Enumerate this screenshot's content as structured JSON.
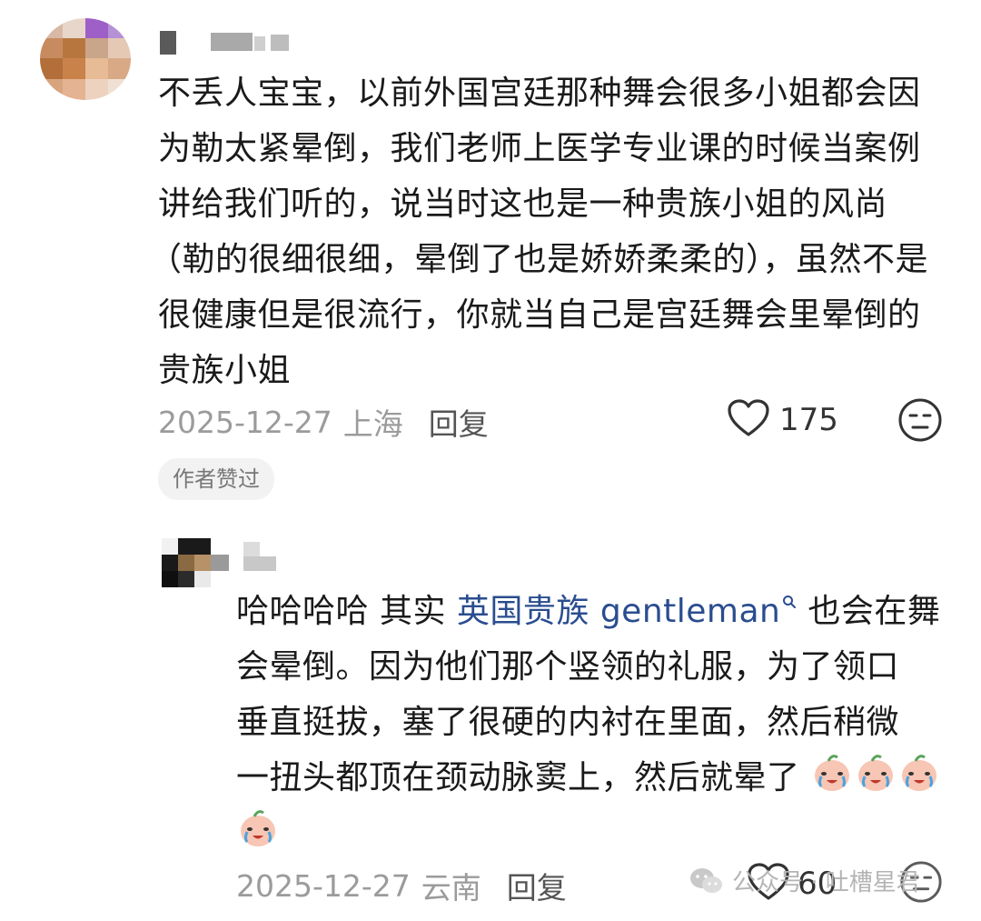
{
  "comments": [
    {
      "text_lines": [
        "不丢人宝宝，以前外国宫廷那种舞会很多小姐都会因",
        "为勒太紧晕倒，我们老师上医学专业课的时候当案例",
        "讲给我们听的，说当时这也是一种贵族小姐的风尚",
        "（勒的很细很细，晕倒了也是娇娇柔柔的），虽然不是",
        "很健康但是很流行，你就当自己是宫廷舞会里晕倒的",
        "贵族小姐"
      ],
      "date": "2025-12-27",
      "location": "上海",
      "reply_label": "回复",
      "like_count": "175",
      "badge": "作者赞过"
    },
    {
      "line1_prefix": "哈哈哈哈 其实 ",
      "link_text": "英国贵族 gentleman",
      "line1_suffix": " 也会在舞",
      "text_lines": [
        "会晕倒。因为他们那个竖领的礼服，为了领口",
        "垂直挺拔，塞了很硬的内衬在里面，然后稍微",
        "一扭头都顶在颈动脉窦上，然后就晕了"
      ],
      "date": "2025-12-27",
      "location": "云南",
      "reply_label": "回复",
      "like_count": "60"
    }
  ],
  "watermark": {
    "text": "公众号 · 吐槽星君",
    "icon": "wechat-icon"
  },
  "colors": {
    "link": "#2a4d8f",
    "meta": "#9b9b9b",
    "badge_bg": "#f2f2f2"
  }
}
